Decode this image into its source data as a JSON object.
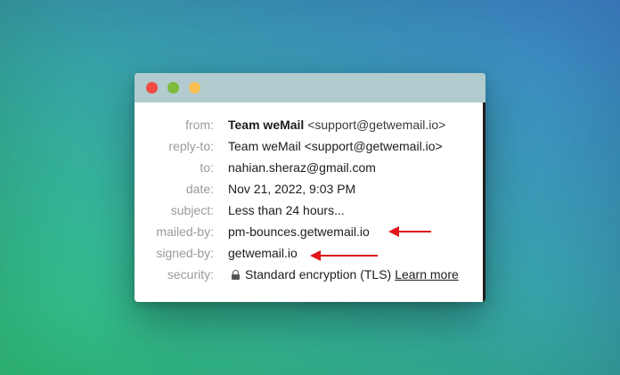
{
  "window": {
    "controls": [
      "close",
      "minimize",
      "zoom"
    ]
  },
  "header_fields": {
    "from_label": "from:",
    "from_name": "Team weMail",
    "from_address": "<support@getwemail.io>",
    "reply_to_label": "reply-to:",
    "reply_to_value": "Team weMail <support@getwemail.io>",
    "to_label": "to:",
    "to_value": "nahian.sheraz@gmail.com",
    "date_label": "date:",
    "date_value": "Nov 21, 2022, 9:03 PM",
    "subject_label": "subject:",
    "subject_value": "Less than 24 hours...",
    "mailed_by_label": "mailed-by:",
    "mailed_by_value": "pm-bounces.getwemail.io",
    "signed_by_label": "signed-by:",
    "signed_by_value": "getwemail.io",
    "security_label": "security:",
    "security_value": "Standard encryption (TLS)",
    "security_link": "Learn more"
  },
  "icons": {
    "security": "lock-icon"
  },
  "colors": {
    "annotation_arrow": "#e0151b",
    "titlebar": "#b2cbcf",
    "label_text": "#9a9a9a"
  }
}
